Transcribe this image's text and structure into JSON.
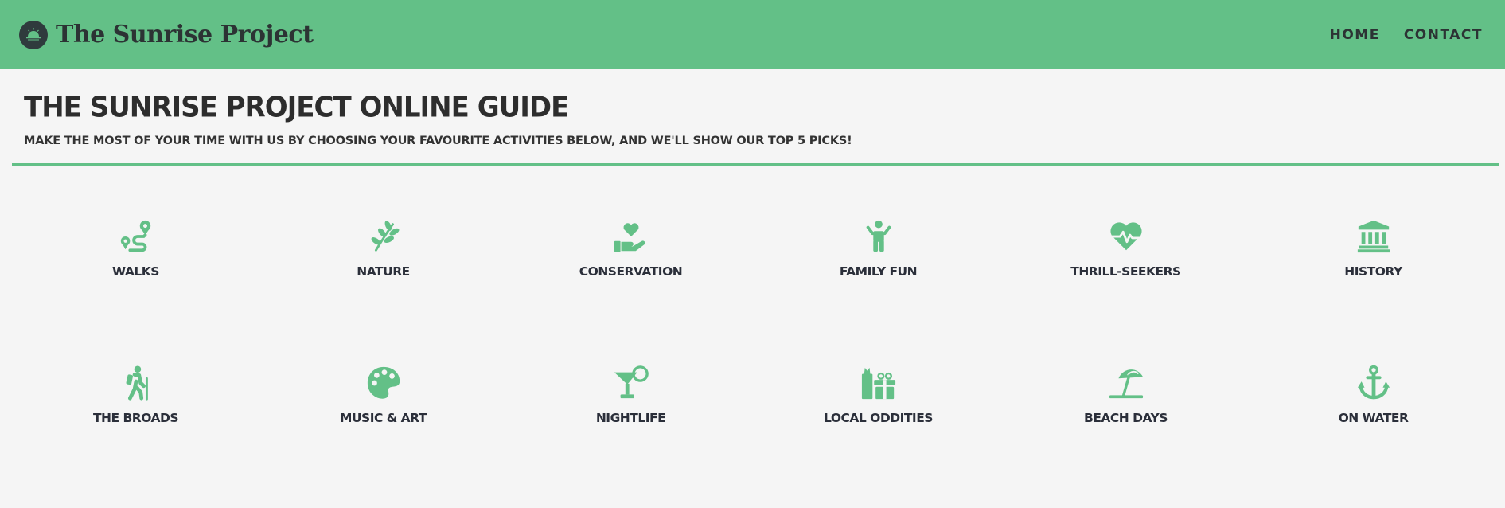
{
  "header": {
    "brand": "The Sunrise Project",
    "logo_icon": "sunrise-logo-icon",
    "nav": [
      {
        "label": "HOME"
      },
      {
        "label": "CONTACT"
      }
    ]
  },
  "intro": {
    "title": "THE SUNRISE PROJECT ONLINE GUIDE",
    "subtitle": "MAKE THE MOST OF YOUR TIME WITH US BY CHOOSING YOUR FAVOURITE ACTIVITIES BELOW, AND WE'LL SHOW OUR TOP 5 PICKS!"
  },
  "activities": [
    {
      "label": "WALKS",
      "icon": "route-icon"
    },
    {
      "label": "NATURE",
      "icon": "seedling-icon"
    },
    {
      "label": "CONSERVATION",
      "icon": "hand-holding-heart-icon"
    },
    {
      "label": "FAMILY FUN",
      "icon": "child-icon"
    },
    {
      "label": "THRILL-SEEKERS",
      "icon": "heartbeat-icon"
    },
    {
      "label": "HISTORY",
      "icon": "landmark-icon"
    },
    {
      "label": "THE BROADS",
      "icon": "hiking-icon"
    },
    {
      "label": "MUSIC & ART",
      "icon": "palette-icon"
    },
    {
      "label": "NIGHTLIFE",
      "icon": "cocktail-icon"
    },
    {
      "label": "LOCAL ODDITIES",
      "icon": "gifts-icon"
    },
    {
      "label": "BEACH DAYS",
      "icon": "umbrella-beach-icon"
    },
    {
      "label": "ON WATER",
      "icon": "anchor-icon"
    }
  ],
  "colors": {
    "accent": "#63c087",
    "text": "#2d2d2d",
    "background": "#f5f5f5"
  }
}
